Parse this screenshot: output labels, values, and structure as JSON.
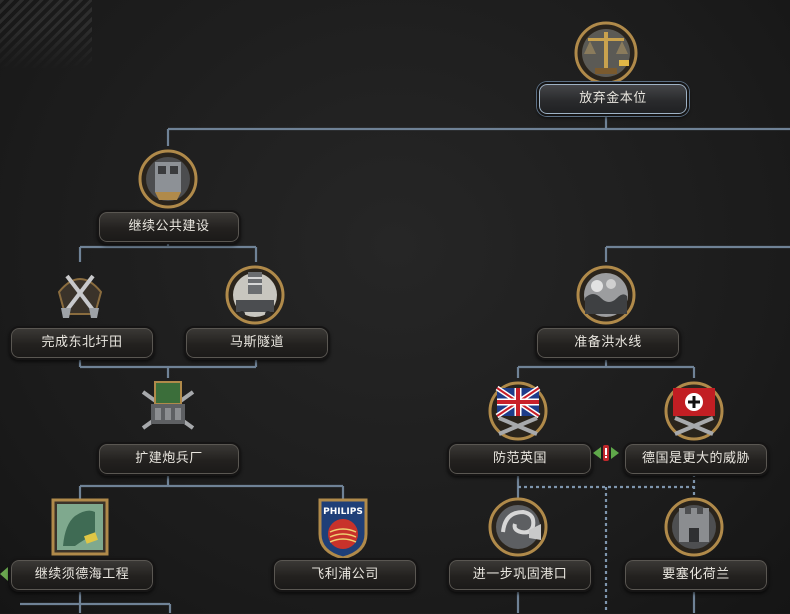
{
  "focus_tree": {
    "nodes": [
      {
        "id": "abandon-gold-standard",
        "label": "放弃金本位",
        "icon": "scales-icon",
        "selected": true
      },
      {
        "id": "continue-public-works",
        "label": "继续公共建设",
        "icon": "construction-icon"
      },
      {
        "id": "complete-northeast-polder",
        "label": "完成东北圩田",
        "icon": "shovels-icon"
      },
      {
        "id": "maas-tunnel",
        "label": "马斯隧道",
        "icon": "tunnel-icon"
      },
      {
        "id": "expand-artillery-factory",
        "label": "扩建炮兵厂",
        "icon": "artillery-factory-icon"
      },
      {
        "id": "continue-zuiderzee-works",
        "label": "继续须德海工程",
        "icon": "map-icon"
      },
      {
        "id": "philips",
        "label": "飞利浦公司",
        "icon": "philips-icon",
        "icon_text": "PHILIPS"
      },
      {
        "id": "prepare-water-line",
        "label": "准备洪水线",
        "icon": "flood-icon"
      },
      {
        "id": "guard-against-britain",
        "label": "防范英国",
        "icon": "british-flag-icon"
      },
      {
        "id": "germany-bigger-threat",
        "label": "德国是更大的威胁",
        "icon": "german-flag-icon"
      },
      {
        "id": "further-consolidate-ports",
        "label": "进一步巩固港口",
        "icon": "naval-mine-icon"
      },
      {
        "id": "fortify-netherlands",
        "label": "要塞化荷兰",
        "icon": "fortress-icon"
      }
    ],
    "mutually_exclusive_marker": "exclusive-icon"
  },
  "colors": {
    "line": "#6f8296",
    "label_text": "#e9e6df",
    "frame_gold": "#b08a4a"
  }
}
